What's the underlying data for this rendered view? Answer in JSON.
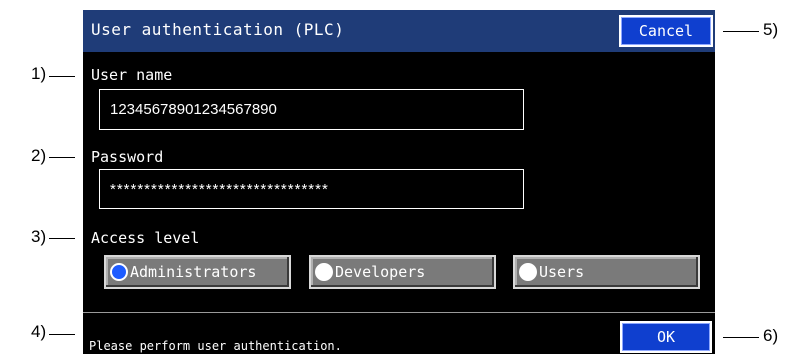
{
  "callouts": {
    "c1": "1)",
    "c2": "2)",
    "c3": "3)",
    "c4": "4)",
    "c5": "5)",
    "c6": "6)"
  },
  "dialog": {
    "title": "User authentication (PLC)",
    "cancel_label": "Cancel",
    "ok_label": "OK",
    "user_name_label": "User name",
    "user_name_value": "12345678901234567890",
    "password_label": "Password",
    "password_value": "********************************",
    "access_level_label": "Access level",
    "access_levels": [
      "Administrators",
      "Developers",
      "Users"
    ],
    "selected_access_level": "Administrators",
    "status_message": "Please perform user authentication."
  },
  "colors": {
    "screen_background": "#000000",
    "titlebar": "#1f3c78",
    "button_blue": "#0f3fcf",
    "radio_selected": "#1e5cff"
  }
}
